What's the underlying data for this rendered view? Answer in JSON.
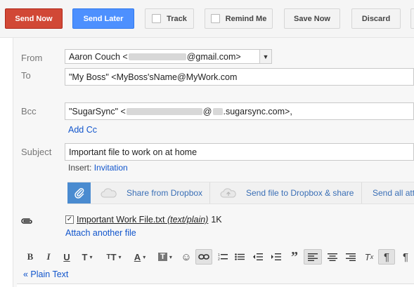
{
  "toolbar": {
    "send_now": "Send Now",
    "send_later": "Send Later",
    "track": "Track",
    "remind_me": "Remind Me",
    "save_now": "Save Now",
    "discard": "Discard"
  },
  "from": {
    "label": "From",
    "name": "Aaron Couch <",
    "domain": "@gmail.com>"
  },
  "to": {
    "label": "To",
    "value": "\"My Boss\" <MyBoss'sName@MyWork.com"
  },
  "bcc": {
    "label": "Bcc",
    "prefix": "\"SugarSync\" <",
    "at": "@",
    "suffix": ".sugarsync.com>,"
  },
  "add_cc": "Add Cc",
  "subject": {
    "label": "Subject",
    "value": "Important file to work on at home"
  },
  "insert": {
    "label": "Insert:",
    "link": "Invitation"
  },
  "dropbox": {
    "share": "Share from Dropbox",
    "send": "Send file to Dropbox & share",
    "send_all": "Send all att"
  },
  "attachment": {
    "name": "Important Work File.txt",
    "type": "(text/plain)",
    "size": "1K",
    "checked": true
  },
  "attach_another": "Attach another file",
  "plain_text": "« Plain Text",
  "colors": {
    "red": "#d14836",
    "blue": "#4d90fe",
    "link": "#1155cc"
  }
}
